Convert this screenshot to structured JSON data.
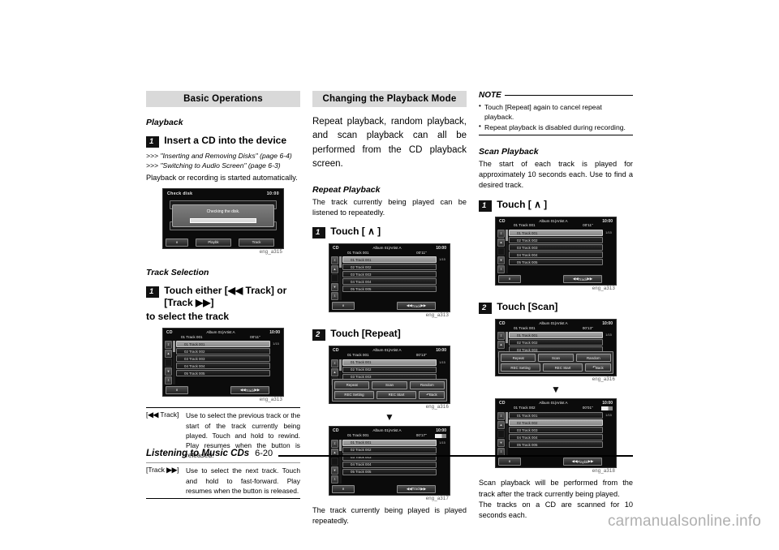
{
  "footer": {
    "title": "Listening to Music CDs",
    "page": "6-20"
  },
  "watermark": "carmanualsonline.info",
  "col1": {
    "section_title": "Basic Operations",
    "playback_head": "Playback",
    "step1_num": "1",
    "step1_text": "Insert a CD into the device",
    "ref1": ">>> \"Inserting and Removing Disks\" (page 6-4)",
    "ref2": ">>> \"Switching to Audio Screen\" (page 6-3)",
    "auto_text": "Playback or recording is started automatically.",
    "check_screen": {
      "title": "Check disk",
      "clock": "10:00",
      "dialog_text": "Checking the disk.",
      "play_btn": "Playbk",
      "track_btn": "Track"
    },
    "caption1": "eng_a315",
    "track_sel_head": "Track Selection",
    "step2_num": "1",
    "step2_text_a": "Touch either [",
    "step2_text_b": " Track] or [Track ",
    "step2_text_c": "]",
    "step2_text_line2": "to select the track",
    "caption2": "eng_a313",
    "table": [
      {
        "key": "[ Track]",
        "desc": "Use to select the previous track or the start of the track currently being played. Touch and hold to rewind. Play resumes when the button is released."
      },
      {
        "key": "[Track ]",
        "desc": "Use to select the next track. Touch and hold to fast-forward. Play resumes when the button is released."
      }
    ]
  },
  "col2": {
    "section_title": "Changing the Playback Mode",
    "intro": "Repeat playback, random playback, and scan playback can all be performed from the CD playback screen.",
    "repeat_head": "Repeat Playback",
    "repeat_intro": "The track currently being played can be listened to repeatedly.",
    "step1_num": "1",
    "step1_text": "Touch [ ∧ ]",
    "caption1": "eng_a313",
    "step2_num": "2",
    "step2_text": "Touch [Repeat]",
    "caption2": "eng_a316",
    "caption3": "eng_a317",
    "closing": "The track currently being played is played repeatedly.",
    "screen_time_1": "00’11’’",
    "screen_time_2": "00’13’’",
    "screen_time_3": "00’17’’"
  },
  "col3": {
    "note_title": "NOTE",
    "notes": [
      "Touch [Repeat] again to cancel repeat playback.",
      "Repeat playback is disabled during recording."
    ],
    "scan_head": "Scan Playback",
    "scan_intro": "The start of each track is played for approximately 10 seconds each. Use to find a desired track.",
    "step1_num": "1",
    "step1_text": "Touch [ ∧ ]",
    "caption1": "eng_a313",
    "step2_num": "2",
    "step2_text": "Touch [Scan]",
    "caption2": "eng_a316",
    "caption3": "eng_a318",
    "closing1": "Scan playback will be performed from the track after the track currently being played.",
    "closing2": "The tracks on a CD are scanned for 10 seconds each.",
    "screen_time_1": "00’11’’",
    "screen_time_2": "00’13’’",
    "screen_time_3": "00’01’’"
  },
  "device": {
    "source": "CD",
    "album_line": "Album 01|Artist A",
    "track_line": "01 Track 001",
    "track_line_alt": "01 Track 002",
    "clock": "10:00",
    "page_indicator": "1/15",
    "tracks": [
      "01  Track 001",
      "02  Track 002",
      "03  Track 003",
      "04  Track 004",
      "05  Track 005"
    ],
    "up_btn": "∧",
    "track_btn": "Track",
    "play_btn": "Playbk",
    "mode_buttons": [
      "Repeat",
      "Scan",
      "Random"
    ],
    "rec_buttons": [
      "REC Setting",
      "REC Start"
    ],
    "back_btn": "Back"
  }
}
